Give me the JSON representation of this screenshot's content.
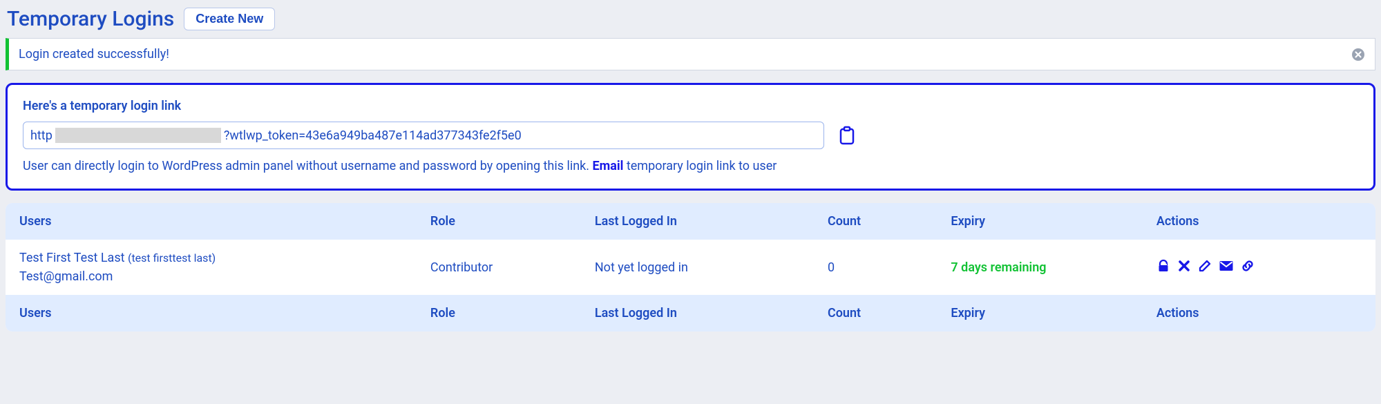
{
  "header": {
    "title": "Temporary Logins",
    "create_button": "Create New"
  },
  "notice": {
    "message": "Login created successfully!"
  },
  "link_panel": {
    "heading": "Here's a temporary login link",
    "url_prefix": "http",
    "url_suffix": "?wtlwp_token=43e6a949ba487e114ad377343fe2f5e0",
    "desc_prefix": "User can directly login to WordPress admin panel without username and password by opening this link. ",
    "email_link": "Email",
    "desc_suffix": " temporary login link to user"
  },
  "table": {
    "headers": {
      "users": "Users",
      "role": "Role",
      "last": "Last Logged In",
      "count": "Count",
      "expiry": "Expiry",
      "actions": "Actions"
    },
    "rows": [
      {
        "display_name": "Test First Test Last",
        "username": "(test firsttest last)",
        "email": "Test@gmail.com",
        "role": "Contributor",
        "last_logged_in": "Not yet logged in",
        "count": "0",
        "expiry": "7 days remaining"
      }
    ]
  }
}
